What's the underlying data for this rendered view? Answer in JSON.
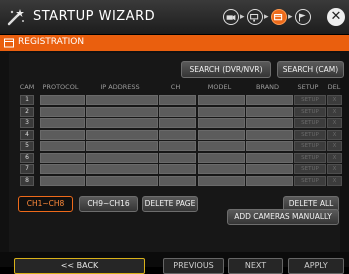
{
  "window": {
    "title": "STARTUP WIZARD"
  },
  "section": {
    "title": "REGISTRATION"
  },
  "search": {
    "dvr_nvr": "SEARCH (DVR/NVR)",
    "cam": "SEARCH (CAM)"
  },
  "table": {
    "headers": {
      "cam": "CAM",
      "protocol": "PROTOCOL",
      "ip": "IP ADDRESS",
      "ch": "CH",
      "model": "MODEL",
      "brand": "BRAND",
      "setup": "SETUP",
      "del": "DEL"
    },
    "rows": [
      "1",
      "2",
      "3",
      "4",
      "5",
      "6",
      "7",
      "8"
    ],
    "setup_label": "SETUP",
    "del_label": "X"
  },
  "pages": {
    "tab1": "CH1~CH8",
    "tab2": "CH9~CH16",
    "delete_page": "DELETE PAGE"
  },
  "actions": {
    "delete_all": "DELETE ALL",
    "add_manually": "ADD CAMERAS MANUALLY"
  },
  "nav": {
    "back": "<< BACK",
    "previous": "PREVIOUS",
    "next": "NEXT",
    "apply": "APPLY"
  },
  "colors": {
    "accent": "#ea5f0e",
    "back_border": "#d8b11a"
  }
}
